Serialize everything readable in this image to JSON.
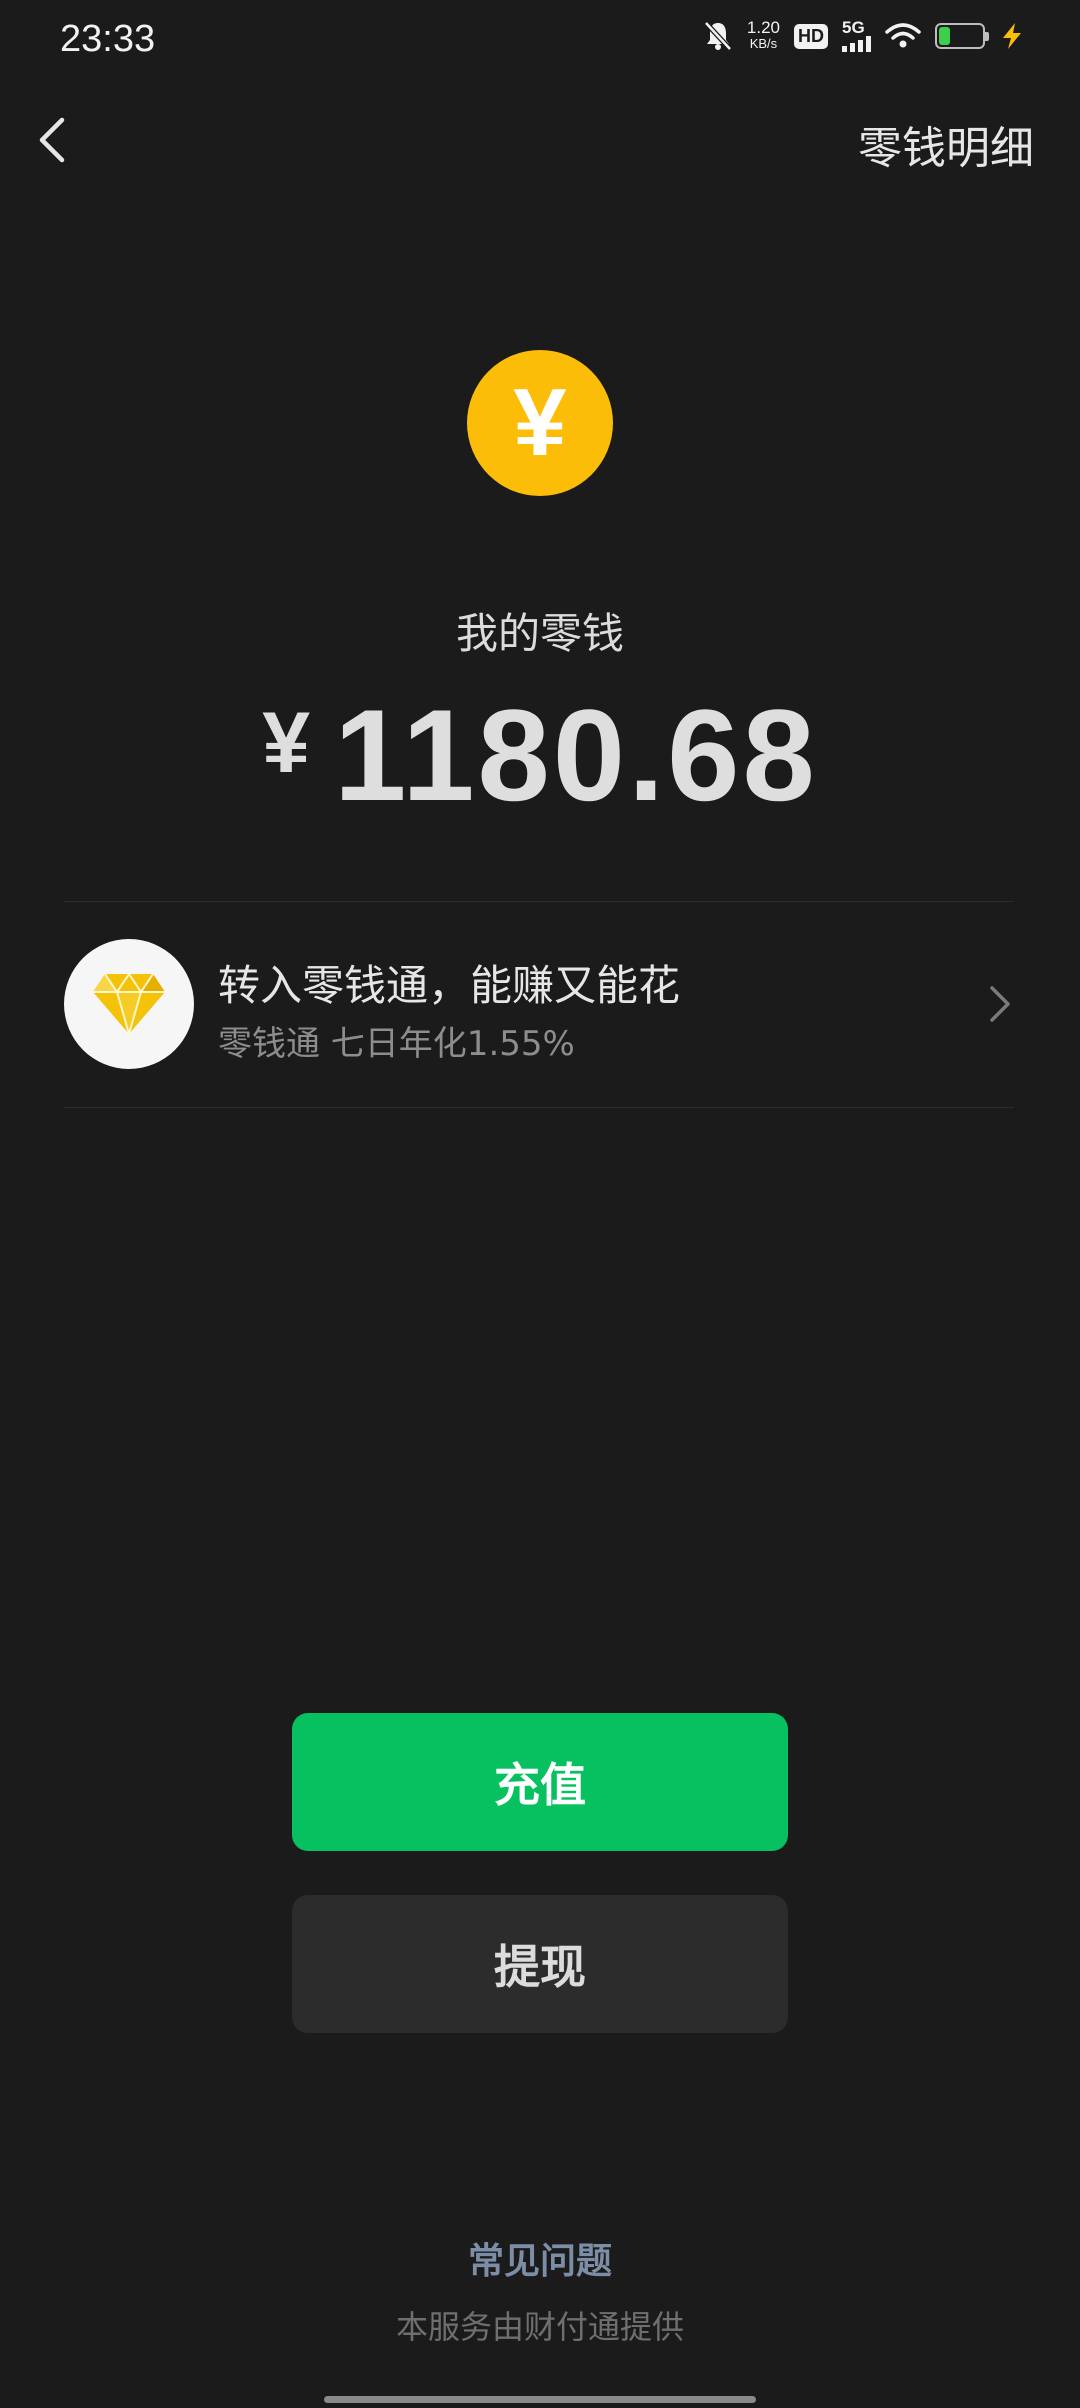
{
  "status_bar": {
    "time": "23:33",
    "speed_value": "1.20",
    "speed_unit": "KB/s",
    "hd_label": "HD",
    "network": "5G",
    "battery": "21",
    "battery_color": "#3ccf4e"
  },
  "nav": {
    "back_icon": "chevron-left-icon",
    "details_link": "零钱明细"
  },
  "wallet": {
    "coin_icon": "yuan-coin-icon",
    "coin_glyph": "¥",
    "label": "我的零钱",
    "currency": "¥",
    "amount": "1180.68"
  },
  "promo": {
    "icon": "diamond-icon",
    "title": "转入零钱通，能赚又能花",
    "subtitle": "零钱通 七日年化1.55%"
  },
  "actions": {
    "recharge": "充值",
    "withdraw": "提现"
  },
  "footer": {
    "faq": "常见问题",
    "provider": "本服务由财付通提供"
  },
  "colors": {
    "background": "#1b1b1b",
    "primary_green": "#07c160",
    "coin_yellow": "#fbbd08",
    "faq_link": "#7c8ea6"
  }
}
